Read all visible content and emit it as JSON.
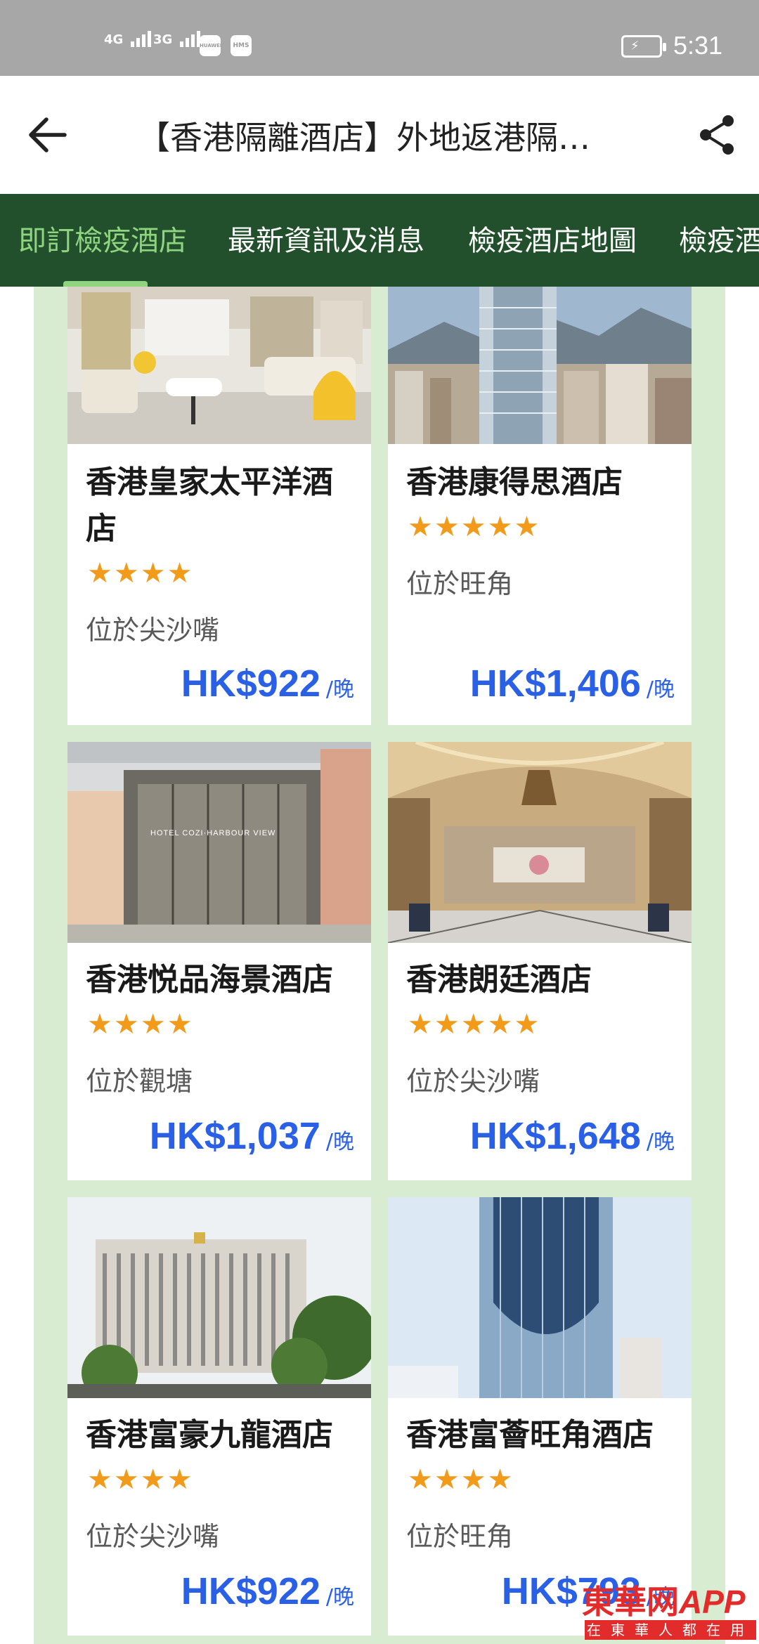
{
  "status_bar": {
    "signal1": "4G",
    "signal2": "3G",
    "app1": "HUAWEI",
    "app2": "HMS",
    "time": "5:31"
  },
  "header": {
    "title": "【香港隔離酒店】外地返港隔…"
  },
  "tabs": [
    {
      "label": "即訂檢疫酒店",
      "active": true
    },
    {
      "label": "最新資訊及消息",
      "active": false
    },
    {
      "label": "檢疫酒店地圖",
      "active": false
    },
    {
      "label": "檢疫酒",
      "active": false
    }
  ],
  "hotels": [
    {
      "name_line1": "香港皇家太平洋酒",
      "name_line2": "店",
      "stars": "★★★★",
      "rating": 4,
      "location": "位於尖沙嘴",
      "price": "HK$922",
      "unit": "/晚"
    },
    {
      "name_line1": "香港康得思酒店",
      "name_line2": "",
      "stars": "★★★★★",
      "rating": 5,
      "location": "位於旺角",
      "price": "HK$1,406",
      "unit": "/晚"
    },
    {
      "name_line1": "香港悦品海景酒店",
      "name_line2": "",
      "stars": "★★★★",
      "rating": 4,
      "location": "位於觀塘",
      "price": "HK$1,037",
      "unit": "/晚",
      "sign": "HOTEL COZI·HARBOUR VIEW"
    },
    {
      "name_line1": "香港朗廷酒店",
      "name_line2": "",
      "stars": "★★★★★",
      "rating": 5,
      "location": "位於尖沙嘴",
      "price": "HK$1,648",
      "unit": "/晚"
    },
    {
      "name_line1": "香港富豪九龍酒店",
      "name_line2": "",
      "stars": "★★★★",
      "rating": 4,
      "location": "位於尖沙嘴",
      "price": "HK$922",
      "unit": "/晚"
    },
    {
      "name_line1": "香港富薈旺角酒店",
      "name_line2": "",
      "stars": "★★★★",
      "rating": 4,
      "location": "位於旺角",
      "price": "HK$793",
      "unit": "/晚"
    }
  ],
  "watermark": {
    "top": "東華网",
    "top_suffix": "APP",
    "bottom": "在東華人都在用"
  },
  "colors": {
    "tab_bg": "#22502c",
    "tab_active": "#8fd57f",
    "panel_bg": "#d7ecd0",
    "price": "#2a60e6",
    "star": "#f29b1a"
  }
}
